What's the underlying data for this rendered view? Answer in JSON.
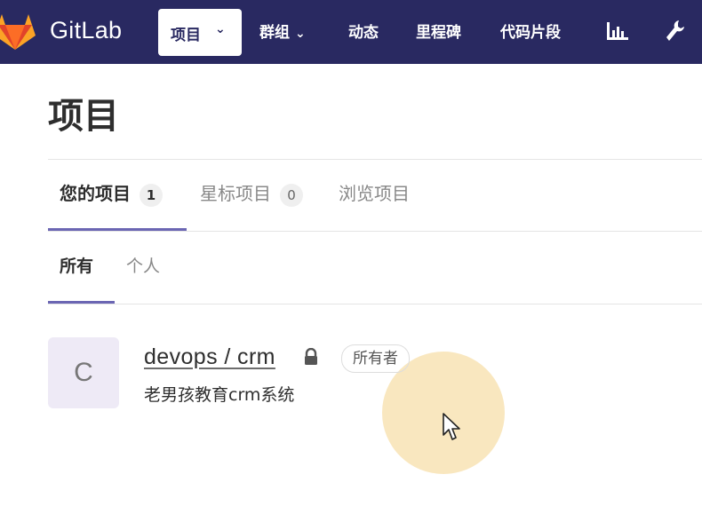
{
  "navbar": {
    "brand": "GitLab",
    "items": [
      {
        "label": "项目",
        "has_dropdown": true,
        "active": true
      },
      {
        "label": "群组",
        "has_dropdown": true
      },
      {
        "label": "动态"
      },
      {
        "label": "里程碑"
      },
      {
        "label": "代码片段"
      }
    ],
    "icons": [
      "activity-chart-icon",
      "admin-wrench-icon"
    ]
  },
  "page": {
    "title": "项目"
  },
  "tabs": [
    {
      "label": "您的项目",
      "count": "1",
      "active": true
    },
    {
      "label": "星标项目",
      "count": "0"
    },
    {
      "label": "浏览项目"
    }
  ],
  "subtabs": [
    {
      "label": "所有",
      "active": true
    },
    {
      "label": "个人"
    }
  ],
  "project": {
    "avatar_letter": "C",
    "name": "devops / crm",
    "visibility_icon": "lock-icon",
    "role_badge": "所有者",
    "description": "老男孩教育crm系统"
  },
  "colors": {
    "navbar": "#292961",
    "tab_underline": "#6b66b3",
    "avatar_bg": "#eeeaf6"
  }
}
